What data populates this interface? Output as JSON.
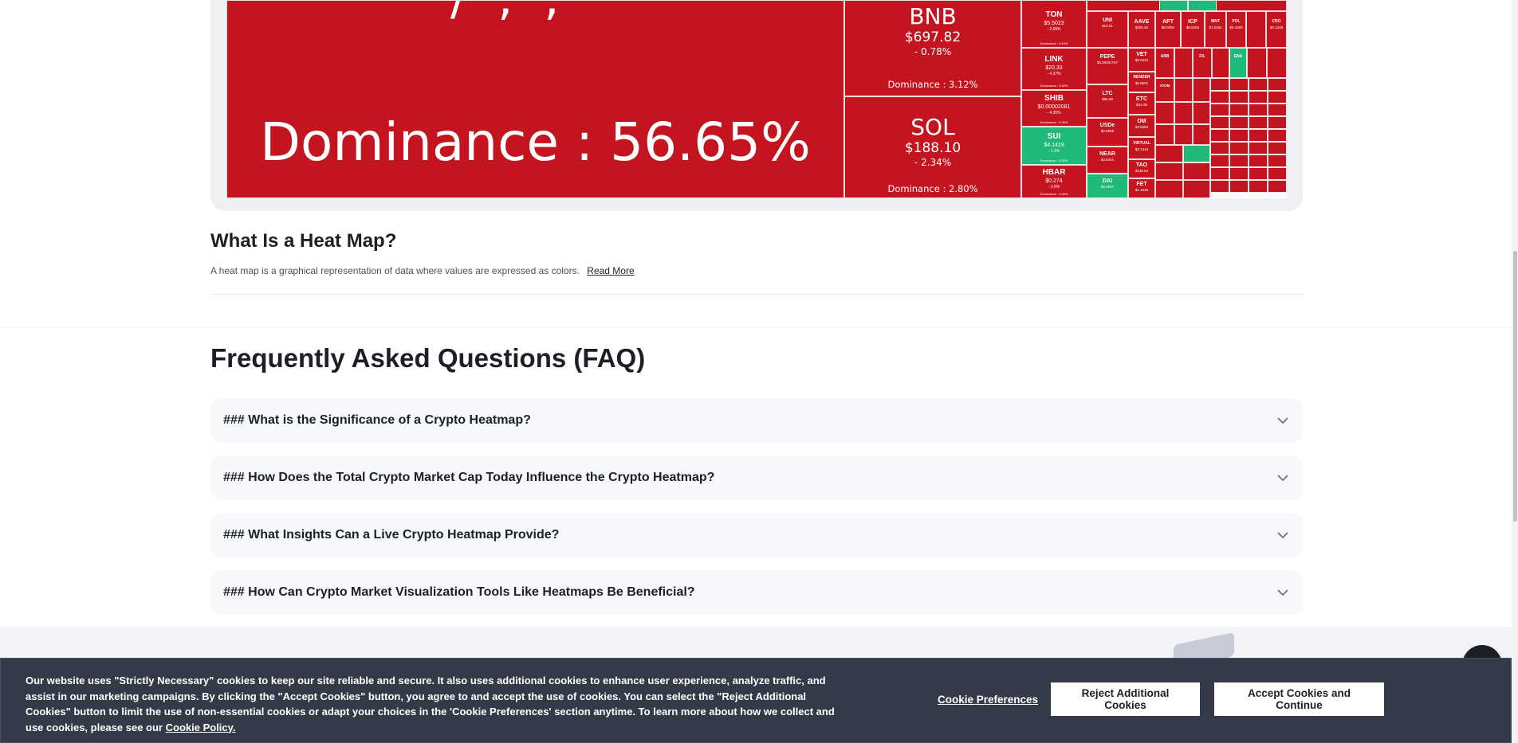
{
  "heatmap": {
    "btc": {
      "dominance": "Dominance : 56.65%",
      "partial_text": "/ ,   ,"
    },
    "bnb": {
      "symbol": "BNB",
      "price": "$697.82",
      "change": "- 0.78%",
      "dominance": "Dominance : 3.12%"
    },
    "sol": {
      "symbol": "SOL",
      "price": "$188.10",
      "change": "- 2.34%",
      "dominance": "Dominance : 2.80%"
    },
    "small": [
      {
        "symbol": "TON",
        "price": "$5.5023",
        "change": "- 3.56%",
        "dominance": "Dominance : 0.43%"
      },
      {
        "symbol": "LINK",
        "price": "$20.33",
        "change": "- 4.37%",
        "dominance": "Dominance : 0.40%"
      },
      {
        "symbol": "SHIB",
        "price": "$0.00002081",
        "change": "- 4.35%",
        "dominance": "Dominance : 0.36%"
      },
      {
        "symbol": "SUI",
        "price": "$4.1419",
        "change": "- 1.1%",
        "dominance": "Dominance : 0.35%"
      },
      {
        "symbol": "HBAR",
        "price": "$0.274",
        "change": "- 3.6%",
        "dominance": "Dominance : 0.30%"
      }
    ],
    "xs": [
      {
        "symbol": "UNI",
        "price": "$13.01",
        "change": "- 4.8%"
      },
      {
        "symbol": "PEPE",
        "price": "$0.00001767",
        "change": "- 5.9%"
      },
      {
        "symbol": "LTC",
        "price": "$96.68",
        "change": "- 4.2%"
      },
      {
        "symbol": "USDe",
        "price": "$0.9999",
        "change": "0.0%"
      },
      {
        "symbol": "NEAR",
        "price": "$4.8401",
        "change": "- 5.1%"
      },
      {
        "symbol": "DAI",
        "price": "$0.9997",
        "change": "0.0%"
      },
      {
        "symbol": "AAVE",
        "price": "$300.46",
        "change": ""
      },
      {
        "symbol": "APT",
        "price": "$8.8094",
        "change": ""
      },
      {
        "symbol": "ICP",
        "price": "$9.8453",
        "change": ""
      },
      {
        "symbol": "VET",
        "price": "$0.0424",
        "change": ""
      },
      {
        "symbol": "RENDER",
        "price": "$6.9501",
        "change": ""
      },
      {
        "symbol": "ETC",
        "price": "$24.49",
        "change": ""
      },
      {
        "symbol": "OM",
        "price": "$3.8584",
        "change": ""
      },
      {
        "symbol": "VIRTUAL",
        "price": "$3.1443",
        "change": ""
      },
      {
        "symbol": "TAO",
        "price": "$448.54",
        "change": ""
      },
      {
        "symbol": "FET",
        "price": "$1.1045",
        "change": ""
      },
      {
        "symbol": "MNT",
        "price": "$1.0264",
        "change": ""
      },
      {
        "symbol": "POL",
        "price": "$0.4393",
        "change": ""
      },
      {
        "symbol": "ENA",
        "price": "$0.8913",
        "change": ""
      },
      {
        "symbol": "CRO",
        "price": "$0.1435",
        "change": ""
      },
      {
        "symbol": "ARB",
        "price": "$0.6918",
        "change": ""
      },
      {
        "symbol": "FIL",
        "price": "$5.0134",
        "change": ""
      },
      {
        "symbol": "ATOM",
        "price": "$5.9946",
        "change": ""
      }
    ]
  },
  "heat_section": {
    "title": "What Is a Heat Map?",
    "description": "A heat map is a graphical representation of data where values are expressed as colors.",
    "read_more": "Read More"
  },
  "faq": {
    "title": "Frequently Asked Questions (FAQ)",
    "items": [
      {
        "question": "### What is the Significance of a Crypto Heatmap?"
      },
      {
        "question": "### How Does the Total Crypto Market Cap Today Influence the Crypto Heatmap?"
      },
      {
        "question": "### What Insights Can a Live Crypto Heatmap Provide?"
      },
      {
        "question": "### How Can Crypto Market Visualization Tools Like Heatmaps Be Beneficial?"
      }
    ]
  },
  "cookie": {
    "text": "Our website uses \"Strictly Necessary\" cookies to keep our site reliable and secure. It also uses additional cookies to enhance user experience, analyze traffic, and assist in our marketing campaigns. By clicking the \"Accept Cookies\" button, you agree to and accept the use of cookies. You can select the \"Reject Additional Cookies\" button to limit the use of non-essential cookies or adapt your choices in the 'Cookie Preferences' section anytime. To learn more about how we collect and use cookies, please see our",
    "policy_link": "Cookie Policy.",
    "preferences": "Cookie Preferences",
    "reject": "Reject Additional Cookies",
    "accept": "Accept Cookies and Continue"
  },
  "colors": {
    "down": "#c4141f",
    "up": "#1fba7a",
    "banner": "#343a48"
  }
}
